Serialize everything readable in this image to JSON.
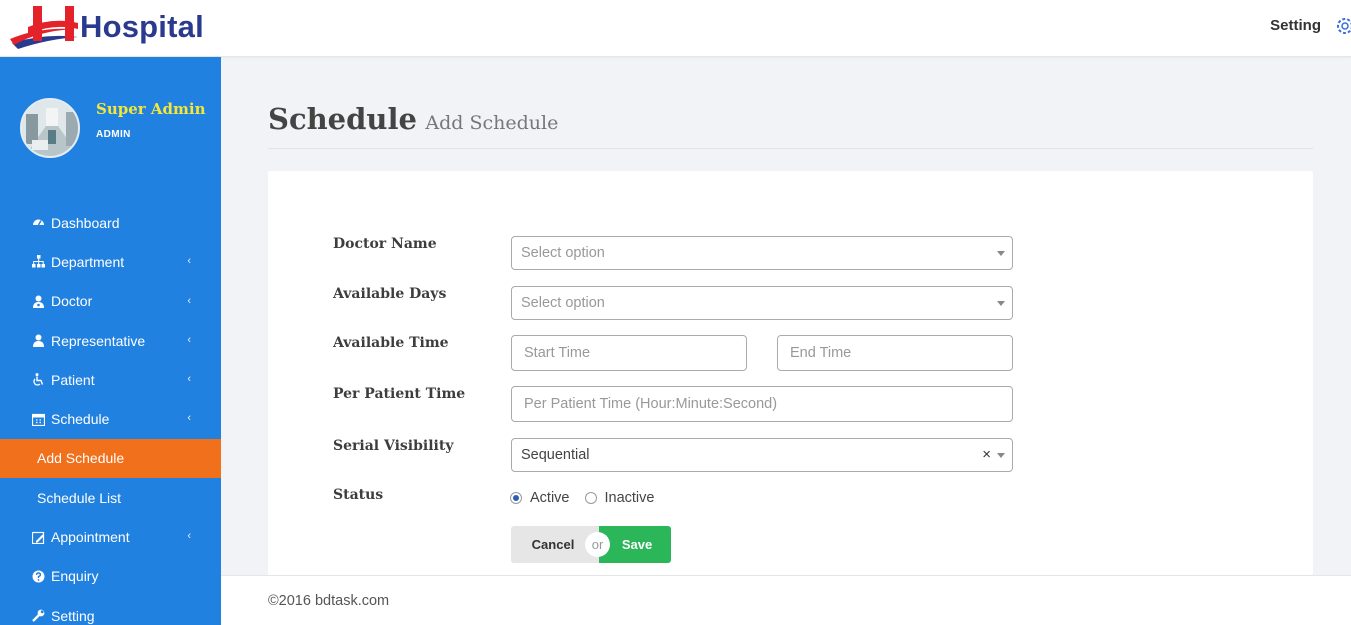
{
  "header": {
    "logo_text": "Hospital",
    "logo_letter": "H",
    "setting_label": "Setting",
    "gear_icon": "gear-icon",
    "brand_colors": {
      "red": "#e4222a",
      "navy": "#2a3a8e"
    }
  },
  "sidebar": {
    "background": "#2181e0",
    "profile": {
      "name": "Super Admin",
      "role": "ADMIN"
    },
    "items": [
      {
        "label": "Dashboard",
        "icon": "dashboard-icon",
        "has_submenu": false
      },
      {
        "label": "Department",
        "icon": "sitemap-icon",
        "has_submenu": true
      },
      {
        "label": "Doctor",
        "icon": "user-doctor-icon",
        "has_submenu": true
      },
      {
        "label": "Representative",
        "icon": "user-icon",
        "has_submenu": true
      },
      {
        "label": "Patient",
        "icon": "wheelchair-icon",
        "has_submenu": true
      },
      {
        "label": "Schedule",
        "icon": "calendar-icon",
        "has_submenu": true,
        "expanded": true
      },
      {
        "label": "Add Schedule",
        "submenu": true,
        "active": true
      },
      {
        "label": "Schedule List",
        "submenu": true
      },
      {
        "label": "Appointment",
        "icon": "calendar-edit-icon",
        "has_submenu": true
      },
      {
        "label": "Enquiry",
        "icon": "question-circle-icon",
        "has_submenu": false
      },
      {
        "label": "Setting",
        "icon": "wrench-icon",
        "has_submenu": false
      }
    ],
    "chevron": "‹",
    "active_color": "#f1701c"
  },
  "page": {
    "title": "Schedule",
    "subtitle": "Add Schedule"
  },
  "form": {
    "doctor_name": {
      "label": "Doctor Name",
      "placeholder": "Select option"
    },
    "available_days": {
      "label": "Available Days",
      "placeholder": "Select option"
    },
    "available_time": {
      "label": "Available Time",
      "start_placeholder": "Start Time",
      "end_placeholder": "End Time"
    },
    "per_patient_time": {
      "label": "Per Patient Time",
      "placeholder": "Per Patient Time (Hour:Minute:Second)"
    },
    "serial_visibility": {
      "label": "Serial Visibility",
      "value": "Sequential",
      "clear": "×"
    },
    "status": {
      "label": "Status",
      "options": [
        "Active",
        "Inactive"
      ],
      "selected": "Active"
    },
    "cancel_label": "Cancel",
    "or_label": "or",
    "save_label": "Save",
    "save_color": "#2bb65a"
  },
  "footer": {
    "text": "©2016 bdtask.com"
  }
}
